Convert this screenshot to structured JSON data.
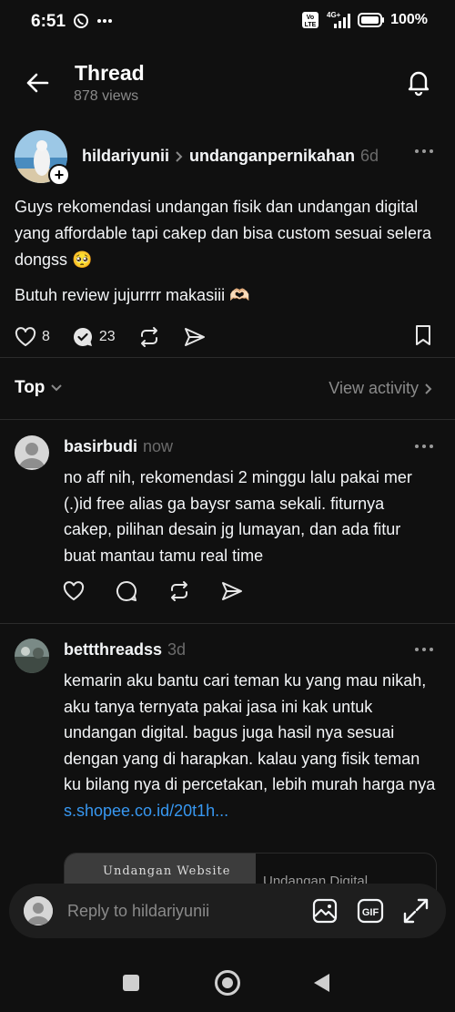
{
  "status_bar": {
    "time": "6:51",
    "network": "4G+",
    "volte": "Vo LTE",
    "battery": "100%"
  },
  "header": {
    "title": "Thread",
    "views": "878 views",
    "back_icon": "arrow-left-icon",
    "bell_icon": "bell-icon"
  },
  "post": {
    "author": "hildariyunii",
    "topic": "undanganpernikahan",
    "time": "6d",
    "body": "Guys rekomendasi undangan fisik dan undangan digital yang affordable tapi cakep dan bisa custom sesuai selera dongss 🥺",
    "body2": "Butuh review jujurrrr makasiii 🫶🏻",
    "likes": "8",
    "replies": "23"
  },
  "sort": {
    "label": "Top",
    "view_activity": "View activity"
  },
  "replies": [
    {
      "author": "basirbudi",
      "time": "now",
      "text": "no aff nih, rekomendasi 2 minggu lalu pakai mer (.)id free alias ga baysr sama sekali. fiturnya cakep, pilihan desain jg lumayan, dan ada fitur buat mantau tamu real time"
    },
    {
      "author": "bettthreadss",
      "time": "3d",
      "text": "kemarin aku bantu cari teman ku yang mau nikah,  aku tanya ternyata pakai jasa ini kak untuk undangan digital. bagus juga hasil nya sesuai dengan yang di harapkan. kalau yang fisik teman ku bilang nya di percetakan, lebih murah harga nya",
      "link": "s.shopee.co.id/20t1h...",
      "card_thumb_text": "Undangan Website",
      "card_title": "Undangan Digital"
    }
  ],
  "reply_bar": {
    "placeholder": "Reply to hildariyunii",
    "gif_label": "GIF"
  }
}
